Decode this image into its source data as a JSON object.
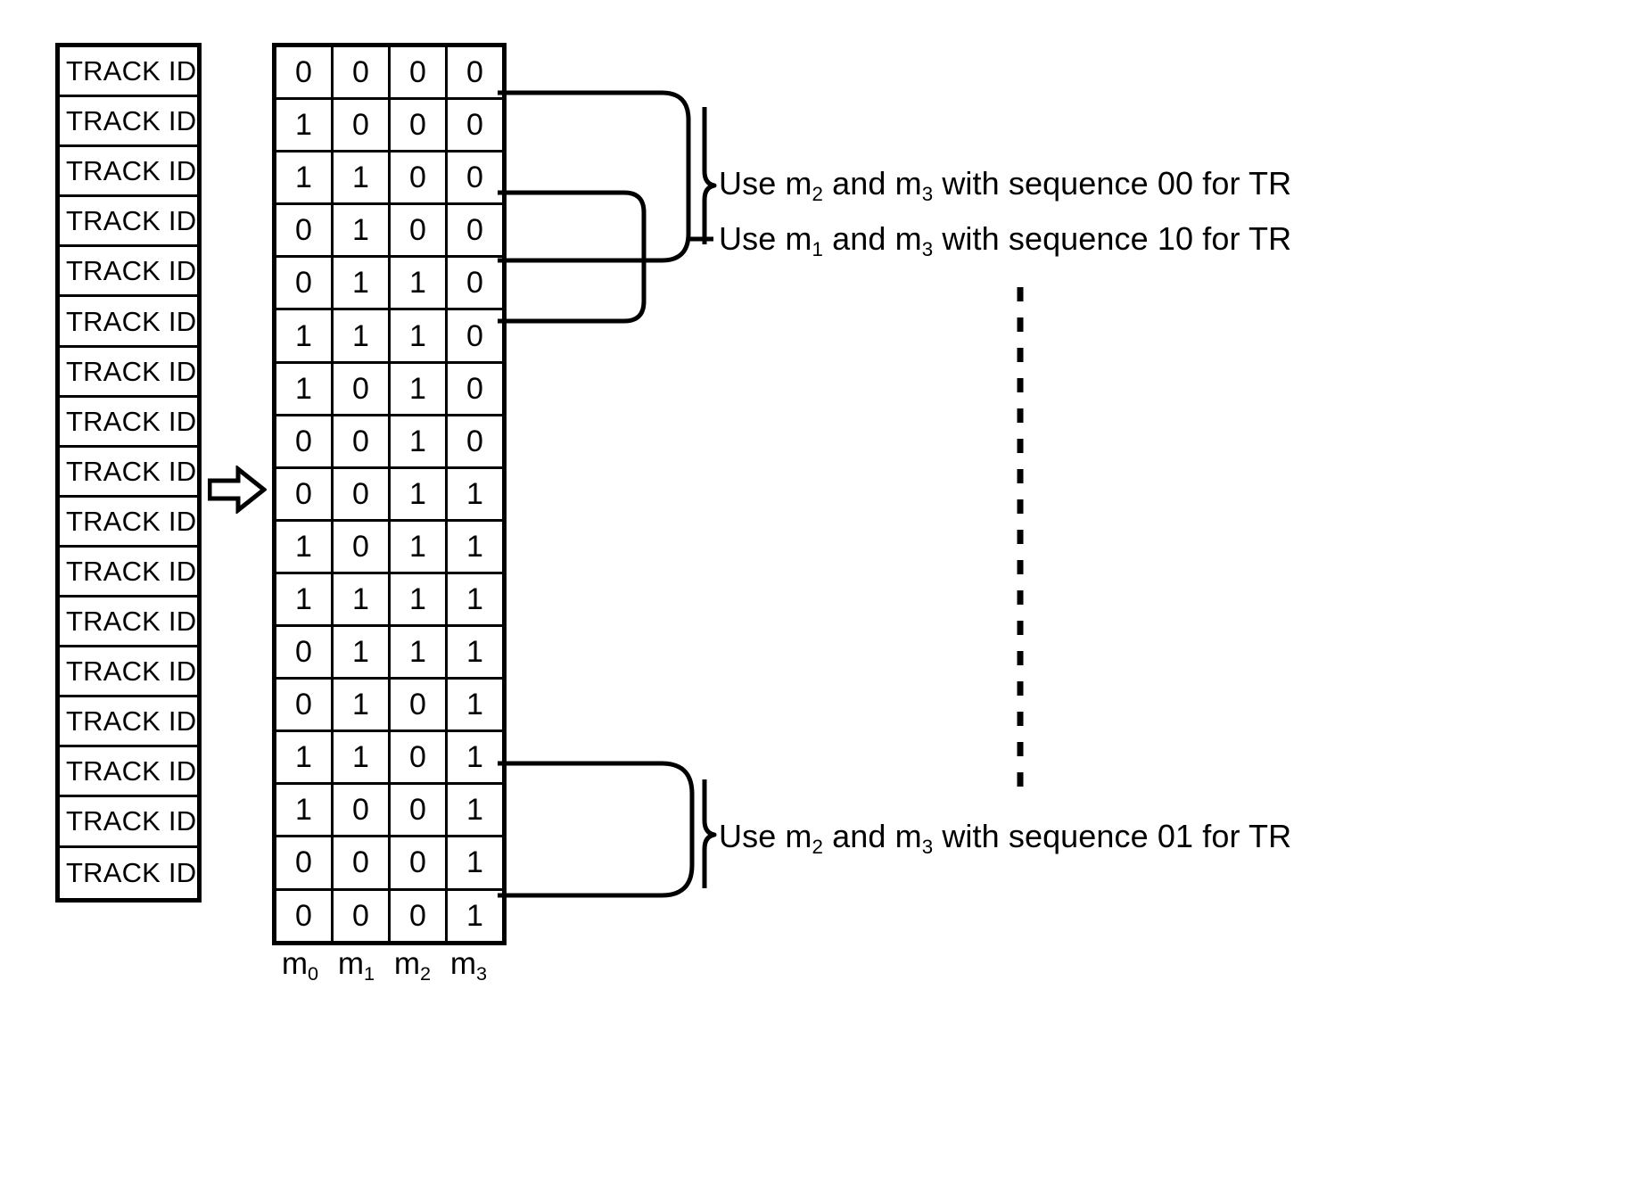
{
  "diagram": {
    "title": "Gray code track ID sequence mapping diagram",
    "track_label": "TRACK ID",
    "arrow_icon": "right-arrow-icon",
    "row_count": 17,
    "column_labels": [
      {
        "base": "m",
        "sub": "0"
      },
      {
        "base": "m",
        "sub": "1"
      },
      {
        "base": "m",
        "sub": "2"
      },
      {
        "base": "m",
        "sub": "3"
      }
    ],
    "track_ids": [
      "TRACK ID",
      "TRACK ID",
      "TRACK ID",
      "TRACK ID",
      "TRACK ID",
      "TRACK ID",
      "TRACK ID",
      "TRACK ID",
      "TRACK ID",
      "TRACK ID",
      "TRACK ID",
      "TRACK ID",
      "TRACK ID",
      "TRACK ID",
      "TRACK ID",
      "TRACK ID",
      "TRACK ID"
    ],
    "bit_rows": [
      [
        "0",
        "0",
        "0",
        "0"
      ],
      [
        "1",
        "0",
        "0",
        "0"
      ],
      [
        "1",
        "1",
        "0",
        "0"
      ],
      [
        "0",
        "1",
        "0",
        "0"
      ],
      [
        "0",
        "1",
        "1",
        "0"
      ],
      [
        "1",
        "1",
        "1",
        "0"
      ],
      [
        "1",
        "0",
        "1",
        "0"
      ],
      [
        "0",
        "0",
        "1",
        "0"
      ],
      [
        "0",
        "0",
        "1",
        "1"
      ],
      [
        "1",
        "0",
        "1",
        "1"
      ],
      [
        "1",
        "1",
        "1",
        "1"
      ],
      [
        "0",
        "1",
        "1",
        "1"
      ],
      [
        "0",
        "1",
        "0",
        "1"
      ],
      [
        "1",
        "1",
        "0",
        "1"
      ],
      [
        "1",
        "0",
        "0",
        "1"
      ],
      [
        "0",
        "0",
        "0",
        "1"
      ],
      [
        "0",
        "0",
        "0",
        "1"
      ]
    ],
    "annotations": [
      {
        "id": "anno-00",
        "text_prefix": "Use m",
        "sub_a": "2",
        "text_mid": " and m",
        "sub_b": "3",
        "text_suffix": " with sequence 00 for TR",
        "full_text": "Use m2 and m3 with sequence 00 for TR",
        "sequence": "00"
      },
      {
        "id": "anno-10",
        "text_prefix": "Use m",
        "sub_a": "1",
        "text_mid": " and m",
        "sub_b": "3",
        "text_suffix": " with sequence 10 for TR",
        "full_text": "Use m1 and m3 with sequence 10 for TR",
        "sequence": "10"
      },
      {
        "id": "anno-01",
        "text_prefix": "Use m",
        "sub_a": "2",
        "text_mid": " and m",
        "sub_b": "3",
        "text_suffix": " with sequence 01 for TR",
        "full_text": "Use m2 and m3 with sequence 01 for TR",
        "sequence": "01"
      }
    ],
    "colors": {
      "ink": "#000000",
      "paper": "#ffffff"
    }
  }
}
